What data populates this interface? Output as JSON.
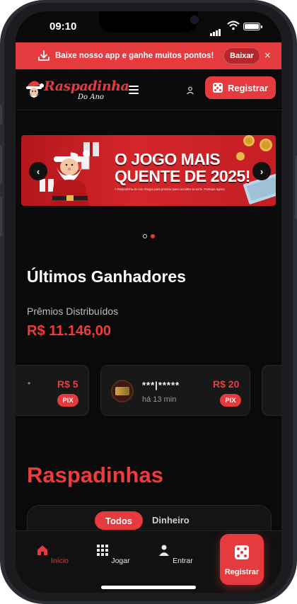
{
  "status_bar": {
    "time": "09:10"
  },
  "promo_bar": {
    "text": "Baixe nosso app e ganhe muitos pontos!",
    "button": "Baixar",
    "close": "×"
  },
  "header": {
    "logo_line1": "Raspadinha",
    "logo_line2": "Do Ano",
    "register_button": "Registrar"
  },
  "banner": {
    "headline": "O JOGO MAIS QUENTE DE 2025!",
    "subtext": "A Raspadinha do Ano chegou para premiar quem acredita na sorte. Participe agora!",
    "total_slides": 2,
    "active_slide": 2
  },
  "winners": {
    "title": "Últimos Ganhadores",
    "prizes_label": "Prêmios Distribuídos",
    "prizes_total": "R$ 11.146,00",
    "cards": [
      {
        "name": "",
        "amount": "R$ 5",
        "method": "PIX",
        "time": ""
      },
      {
        "name": "***|*****",
        "amount": "R$ 20",
        "method": "PIX",
        "time": "há 13 min"
      }
    ]
  },
  "raspadinhas": {
    "title": "Raspadinhas",
    "tabs": [
      "Todos",
      "Dinheiro"
    ],
    "active_tab": "Todos"
  },
  "bottom_nav": {
    "items": [
      {
        "label": "Início",
        "icon": "home-icon",
        "active": true
      },
      {
        "label": "Jogar",
        "icon": "grid-icon",
        "active": false
      },
      {
        "label": "Entrar",
        "icon": "user-icon",
        "active": false
      }
    ],
    "register_button": "Registrar"
  },
  "colors": {
    "accent": "#e53a3e",
    "background": "#0a0a0a",
    "card": "#181818"
  }
}
